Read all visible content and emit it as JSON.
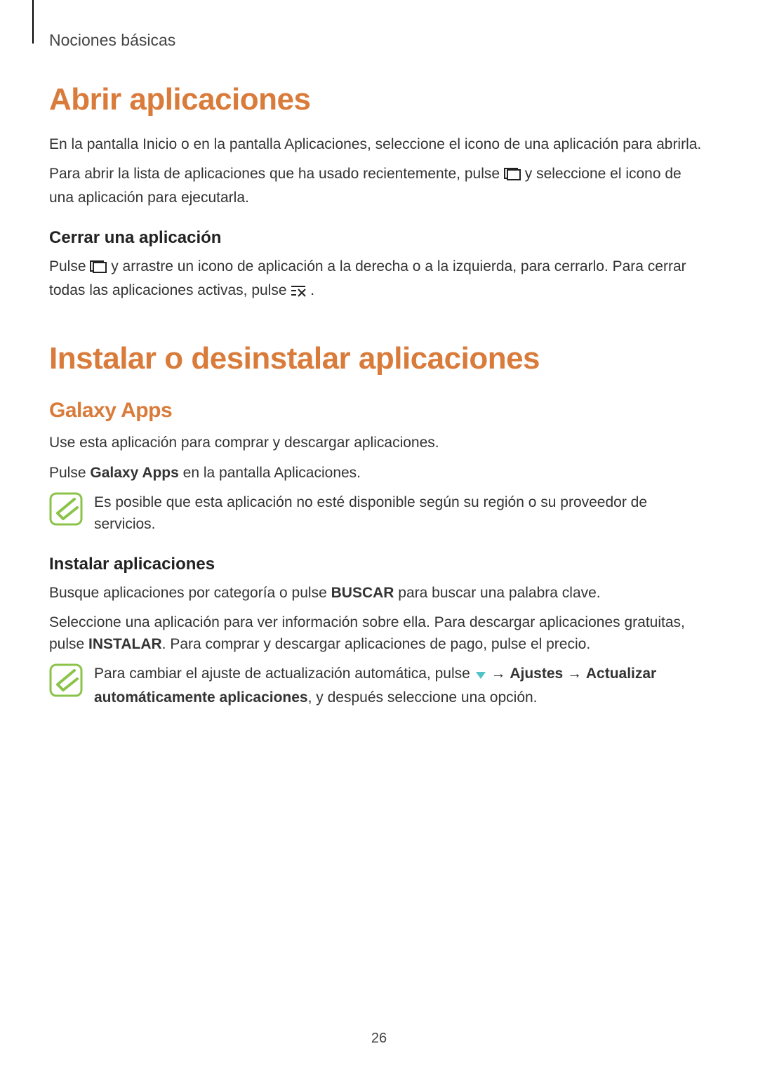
{
  "chapter": "Nociones básicas",
  "section1": {
    "heading": "Abrir aplicaciones",
    "p1": "En la pantalla Inicio o en la pantalla Aplicaciones, seleccione el icono de una aplicación para abrirla.",
    "p2_a": "Para abrir la lista de aplicaciones que ha usado recientemente, pulse ",
    "p2_b": " y seleccione el icono de una aplicación para ejecutarla.",
    "sub1": {
      "heading": "Cerrar una aplicación",
      "p1_a": "Pulse ",
      "p1_b": " y arrastre un icono de aplicación a la derecha o a la izquierda, para cerrarlo. Para cerrar todas las aplicaciones activas, pulse ",
      "p1_c": "."
    }
  },
  "section2": {
    "heading": "Instalar o desinstalar aplicaciones",
    "sub1": {
      "heading": "Galaxy Apps",
      "p1": "Use esta aplicación para comprar y descargar aplicaciones.",
      "p2_a": "Pulse ",
      "p2_bold": "Galaxy Apps",
      "p2_b": " en la pantalla Aplicaciones.",
      "note": "Es posible que esta aplicación no esté disponible según su región o su proveedor de servicios."
    },
    "sub2": {
      "heading": "Instalar aplicaciones",
      "p1_a": "Busque aplicaciones por categoría o pulse ",
      "p1_bold": "BUSCAR",
      "p1_b": " para buscar una palabra clave.",
      "p2_a": "Seleccione una aplicación para ver información sobre ella. Para descargar aplicaciones gratuitas, pulse ",
      "p2_bold": "INSTALAR",
      "p2_b": ". Para comprar y descargar aplicaciones de pago, pulse el precio.",
      "note_a": "Para cambiar el ajuste de actualización automática, pulse ",
      "note_arrow1": " → ",
      "note_bold1": "Ajustes",
      "note_arrow2": " → ",
      "note_bold2": "Actualizar automáticamente aplicaciones",
      "note_b": ", y después seleccione una opción."
    }
  },
  "page_number": "26"
}
